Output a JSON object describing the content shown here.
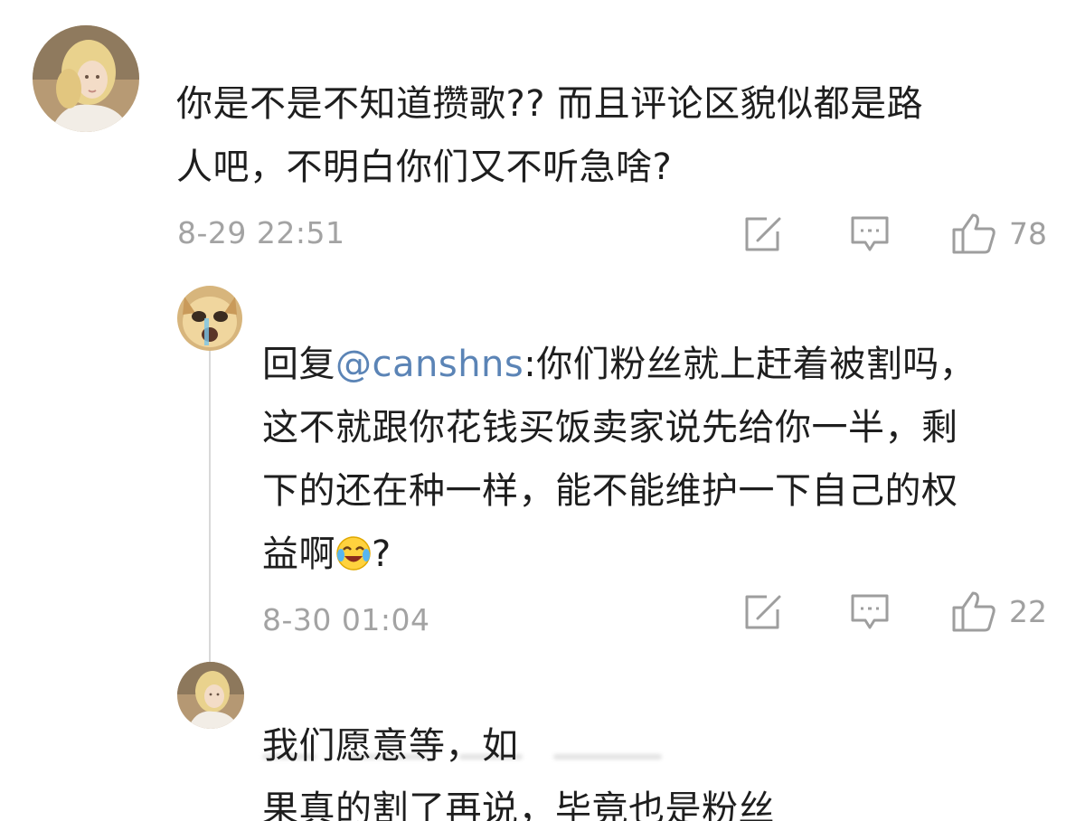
{
  "comments": [
    {
      "text": "你是不是不知道攒歌?? 而且评论区貌似都是路\n人吧，不明白你们又不听急啥?",
      "timestamp": "8-29 22:51",
      "like_count": "78",
      "avatar_icon": "user-avatar-icon",
      "actions": [
        "share-icon",
        "comment-icon",
        "like-icon"
      ]
    },
    {
      "reply_prefix": "回复",
      "mention": "@canshns",
      "text_line1": ":你们粉丝就上赶着被割吗，",
      "text_rest": "这不就跟你花钱买饭卖家说先给你一半，剩\n下的还在种一样，能不能维护一下自己的权\n益啊",
      "text_end": "?",
      "emoji": "laughing-crying-emoji",
      "timestamp": "8-30 01:04",
      "like_count": "22",
      "avatar_icon": "cat-avatar-icon",
      "actions": [
        "share-icon",
        "comment-icon",
        "like-icon"
      ]
    },
    {
      "text": "我们愿意等，如\n果真的割了再说，毕竟也是粉丝",
      "avatar_icon": "user-avatar-icon"
    }
  ],
  "colors": {
    "text": "#1e1e1e",
    "meta": "#a3a3a3",
    "mention": "#5b84b6",
    "thread_line": "#d9d9d9"
  }
}
